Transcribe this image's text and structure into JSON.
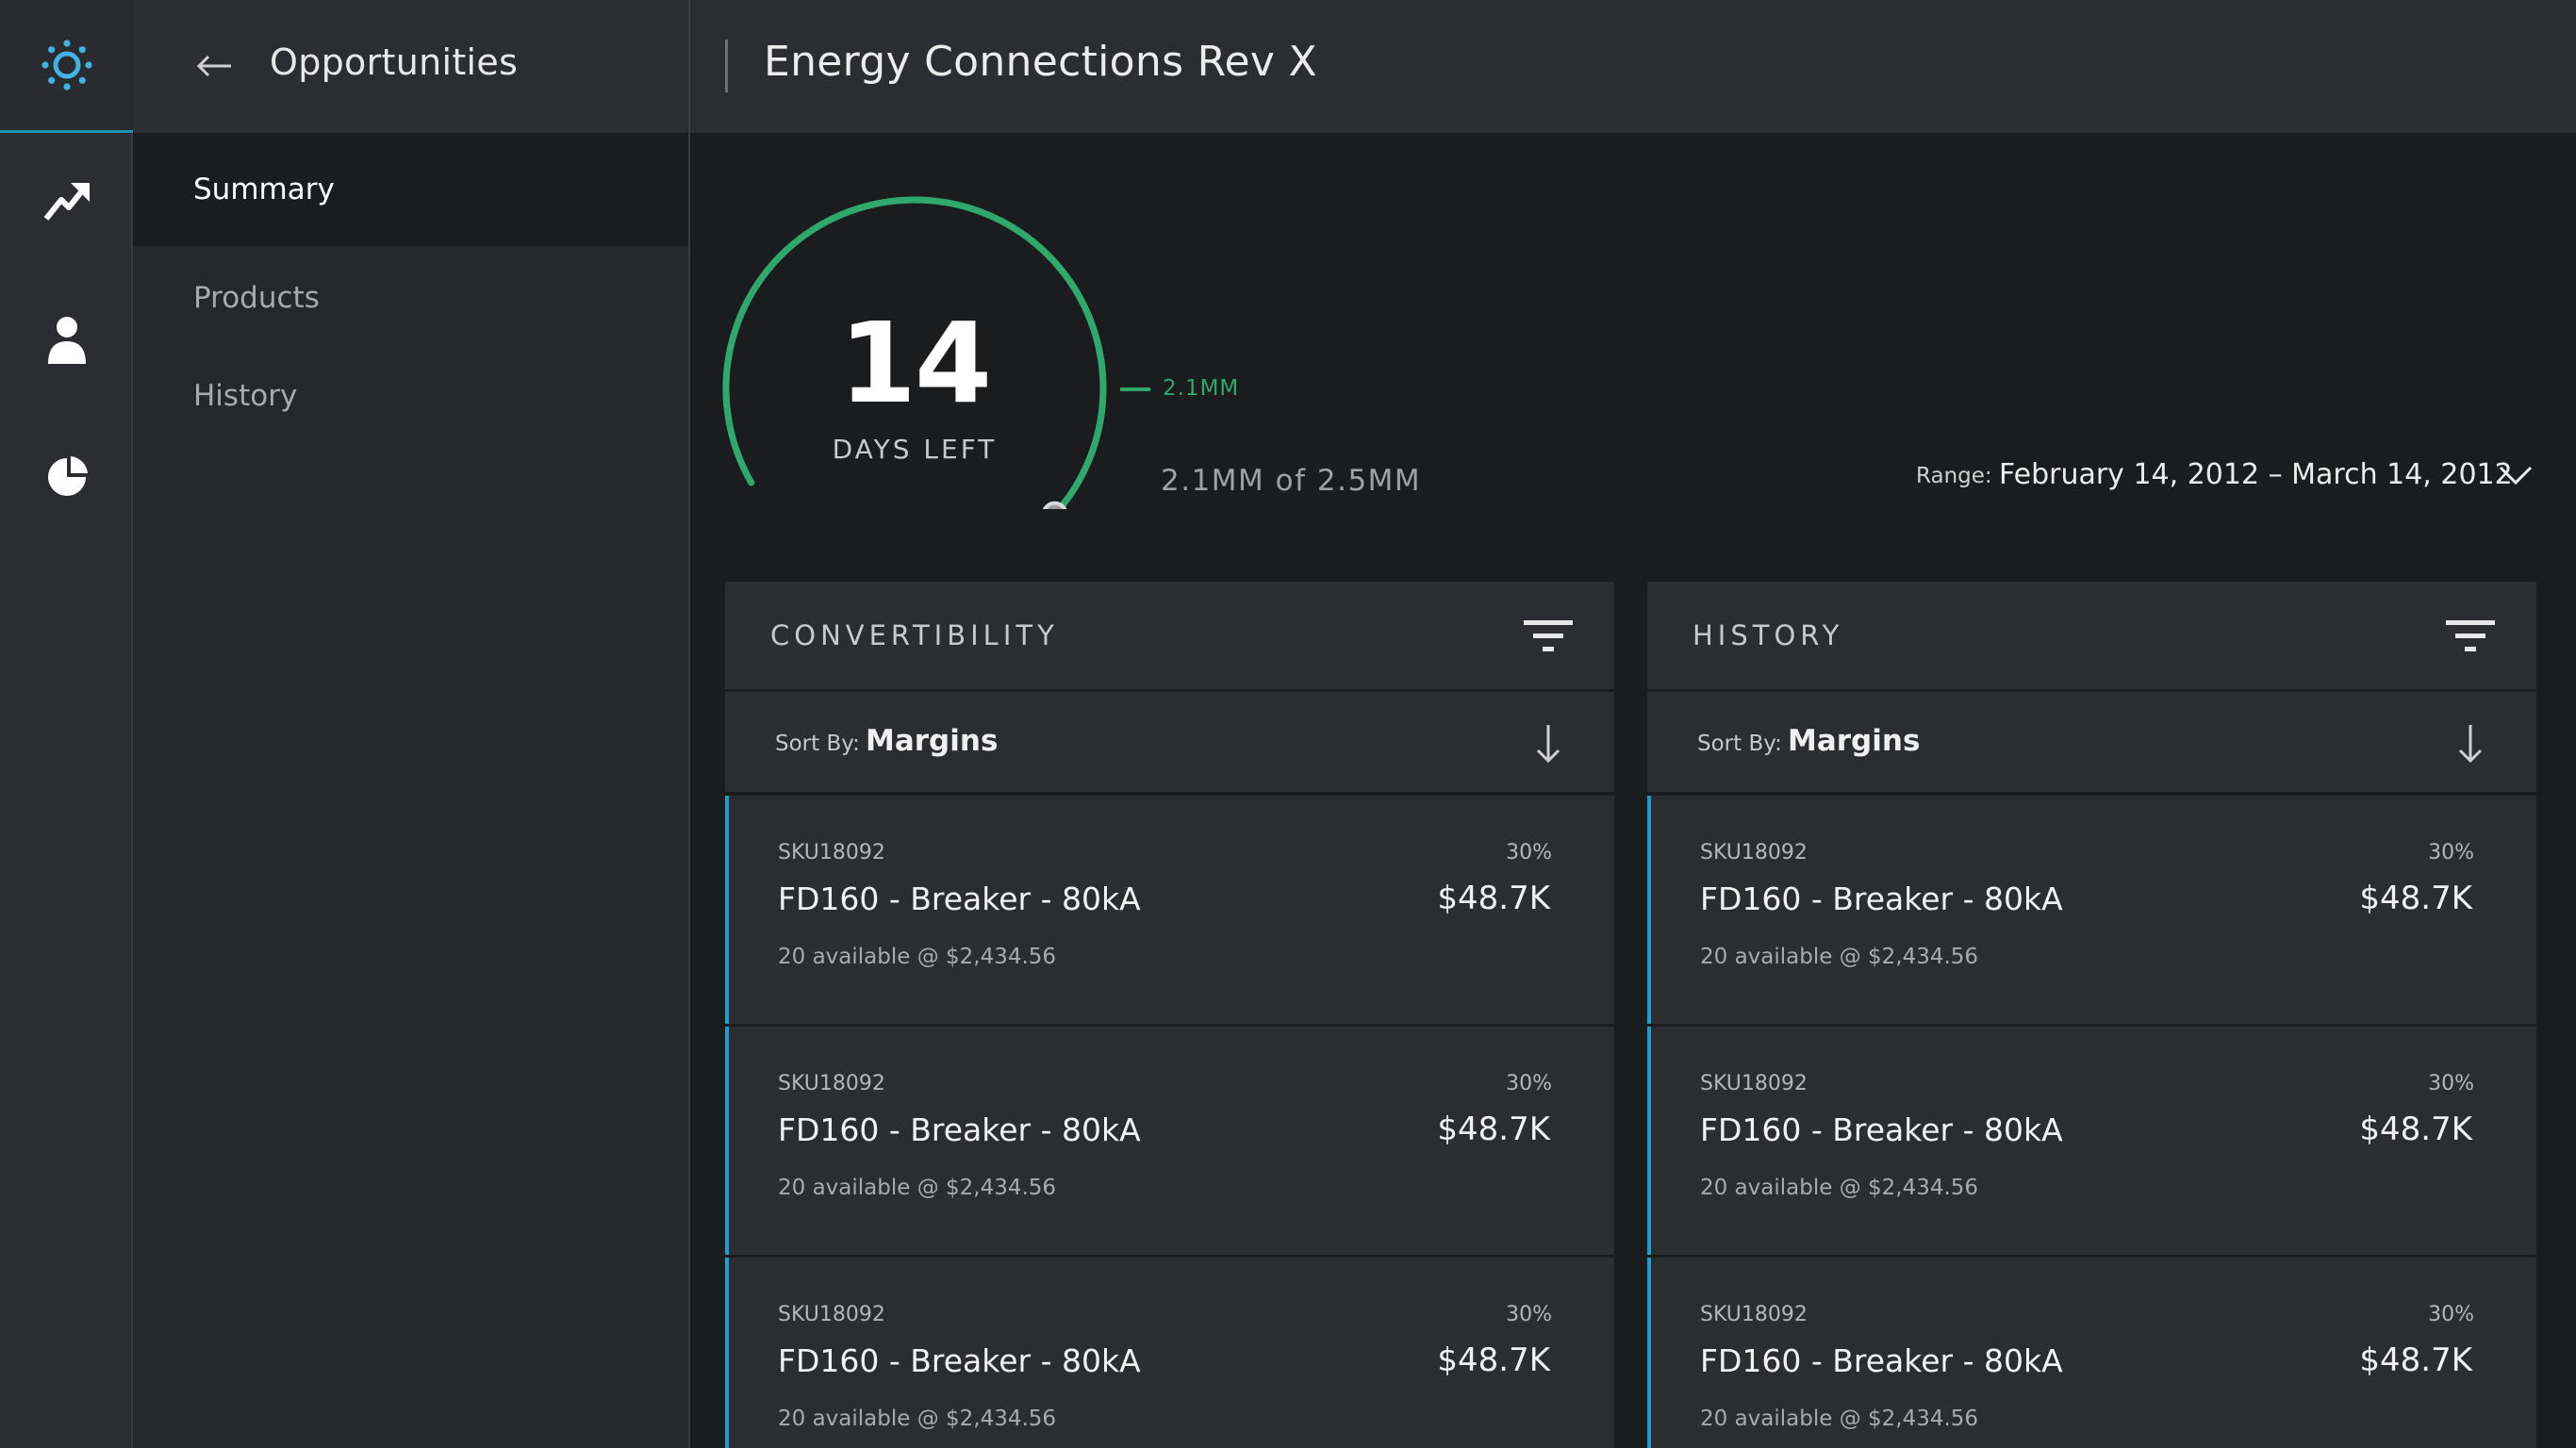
{
  "app": {
    "nav_title": "Opportunities",
    "page_title": "Energy Connections Rev X"
  },
  "rail": {
    "items": [
      {
        "icon": "gear-logo-icon"
      },
      {
        "icon": "trending-arrow-icon"
      },
      {
        "icon": "person-icon"
      },
      {
        "icon": "pie-chart-icon"
      }
    ]
  },
  "subnav": {
    "items": [
      {
        "label": "Summary",
        "active": true
      },
      {
        "label": "Products",
        "active": false
      },
      {
        "label": "History",
        "active": false
      }
    ]
  },
  "gauge": {
    "days_left": "14",
    "days_label": "DAYS LEFT",
    "marker_label": "2.1MM",
    "progress_text": "2.1MM of 2.5MM",
    "progress_fraction": 0.84,
    "accent_color": "#2ea86b"
  },
  "range": {
    "label": "Range:",
    "value": "February 14, 2012 – March 14, 2012"
  },
  "panels": [
    {
      "title": "CONVERTIBILITY",
      "sort_label": "Sort By:",
      "sort_value": "Margins",
      "rows": [
        {
          "sku": "SKU18092",
          "name": "FD160 - Breaker - 80kA",
          "availability": "20 available @ $2,434.56",
          "percent": "30%",
          "amount": "$48.7K"
        },
        {
          "sku": "SKU18092",
          "name": "FD160 - Breaker - 80kA",
          "availability": "20 available @ $2,434.56",
          "percent": "30%",
          "amount": "$48.7K"
        },
        {
          "sku": "SKU18092",
          "name": "FD160 - Breaker - 80kA",
          "availability": "20 available @ $2,434.56",
          "percent": "30%",
          "amount": "$48.7K"
        }
      ]
    },
    {
      "title": "HISTORY",
      "sort_label": "Sort By:",
      "sort_value": "Margins",
      "rows": [
        {
          "sku": "SKU18092",
          "name": "FD160 - Breaker - 80kA",
          "availability": "20 available @ $2,434.56",
          "percent": "30%",
          "amount": "$48.7K"
        },
        {
          "sku": "SKU18092",
          "name": "FD160 - Breaker - 80kA",
          "availability": "20 available @ $2,434.56",
          "percent": "30%",
          "amount": "$48.7K"
        },
        {
          "sku": "SKU18092",
          "name": "FD160 - Breaker - 80kA",
          "availability": "20 available @ $2,434.56",
          "percent": "30%",
          "amount": "$48.7K"
        }
      ]
    }
  ],
  "colors": {
    "accent_blue": "#1b9ed1",
    "accent_green": "#2ea86b"
  }
}
